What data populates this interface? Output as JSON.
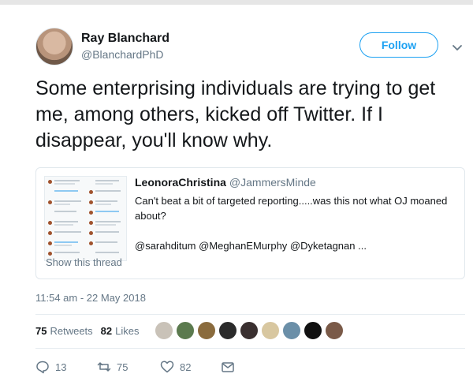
{
  "author": {
    "name": "Ray Blanchard",
    "handle": "@BlanchardPhD"
  },
  "follow_label": "Follow",
  "tweet_text": "Some enterprising individuals are trying to get me, among others, kicked off Twitter. If I disappear, you'll know why.",
  "quoted": {
    "name": "LeonoraChristina",
    "handle": "@JammersMinde",
    "text": "Can't beat a bit of targeted reporting.....was this not what OJ moaned about?",
    "mentions": "@sarahditum @MeghanEMurphy @Dyketagnan ...",
    "show_thread": "Show this thread"
  },
  "timestamp": "11:54 am - 22 May 2018",
  "stats": {
    "retweets_count": "75",
    "retweets_label": "Retweets",
    "likes_count": "82",
    "likes_label": "Likes"
  },
  "liker_colors": [
    "#c9c2b8",
    "#5b7a4e",
    "#8a6b3d",
    "#2b2b2b",
    "#3a3030",
    "#d8c7a0",
    "#6b8fa8",
    "#111111",
    "#7a5a48"
  ],
  "actions": {
    "reply_count": "13",
    "retweet_count": "75",
    "like_count": "82"
  },
  "colors": {
    "accent": "#1da1f2",
    "muted": "#657786"
  }
}
